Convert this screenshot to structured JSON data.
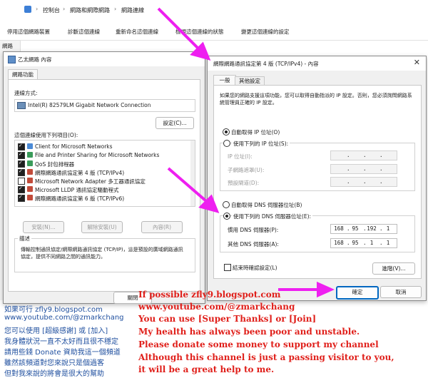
{
  "explorer": {
    "breadcrumb": [
      "控制台",
      "網路和網際網路",
      "網路連線"
    ],
    "toolbar": [
      "停用這個網路裝置",
      "診斷這個連線",
      "重新命名這個連線",
      "檢視這個連線的狀態",
      "變更這個連線的設定"
    ],
    "left_label": "網路"
  },
  "dialog1": {
    "title": "乙太網路 內容",
    "tab": "網路功能",
    "connect_using_label": "連線方式:",
    "adapter": "Intel(R) 82579LM Gigabit Network Connection",
    "configure_btn": "設定(C)...",
    "items_label": "這個連線使用下列項目(O):",
    "items": [
      {
        "label": "Client for Microsoft Networks",
        "checked": true,
        "icon": "network-client-icon"
      },
      {
        "label": "File and Printer Sharing for Microsoft Networks",
        "checked": true,
        "icon": "printer-sharing-icon"
      },
      {
        "label": "QoS 封包排程器",
        "checked": true,
        "icon": "qos-icon"
      },
      {
        "label": "網際網路通訊協定第 4 版 (TCP/IPv4)",
        "checked": true,
        "icon": "protocol-icon"
      },
      {
        "label": "Microsoft Network Adapter 多工器通訊協定",
        "checked": false,
        "icon": "protocol-icon"
      },
      {
        "label": "Microsoft LLDP 通訊協定驅動程式",
        "checked": true,
        "icon": "protocol-icon"
      },
      {
        "label": "網際網路通訊協定第 6 版 (TCP/IPv6)",
        "checked": true,
        "icon": "protocol-icon"
      }
    ],
    "install_btn": "安裝(N)...",
    "uninstall_btn": "解除安裝(U)",
    "properties_btn": "內容(R)",
    "desc_title": "描述",
    "desc_text": "傳輸控制通訊協定/網際網路通訊協定 (TCP/IP)，這是預設的廣域網路通訊協定，提供不同網路之間的通訊能力。",
    "close_btn": "關閉"
  },
  "dialog2": {
    "title": "網際網路通訊協定第 4 版 (TCP/IPv4) - 內容",
    "tabs": [
      "一般",
      "其他設定"
    ],
    "intro": "如果您的網路支援這項功能，您可以取得自動指派的 IP 設定。否則，您必須詢問網路系統管理員正確的 IP 設定。",
    "auto_ip": "自動取得 IP 位址(O)",
    "manual_ip": "使用下列的 IP 位址(S):",
    "ip_label": "IP 位址(I):",
    "mask_label": "子網路遮罩(U):",
    "gateway_label": "預設閘道(D):",
    "auto_dns": "自動取得 DNS 伺服器位址(B)",
    "manual_dns": "使用下列的 DNS 伺服器位址(E):",
    "pref_dns_label": "慣用 DNS 伺服器(P):",
    "pref_dns": [
      "168",
      "95",
      "192",
      "1"
    ],
    "alt_dns_label": "其他 DNS 伺服器(A):",
    "alt_dns": [
      "168",
      "95",
      "1",
      "1"
    ],
    "validate": "結束時確認設定(L)",
    "advanced_btn": "進階(V)...",
    "ok_btn": "確定",
    "cancel_btn": "取消"
  },
  "overlay": {
    "blue": [
      "如果可行 zfly9.blogspot.com",
      "www.youtube.com/@zmarkchang",
      "您可以使用 [超級感謝] 或 [加入]",
      "我身體狀況一直不太好而且很不穩定",
      "請用些錢 Donate 資助我這一個頻道",
      "雖然該頻道對您來說只是個過客",
      "但對我來說的將會是很大的幫助"
    ],
    "red": [
      "If possible zfly9.blogspot.com",
      "www.youtube.com/@zmarkchang",
      "You can use [Super Thanks] or [Join]",
      "My health has always been poor and unstable.",
      "Please donate some money to support my channel",
      "Although this channel is just a passing visitor to you,",
      "it will be a great help to me."
    ]
  },
  "colors": {
    "arrow": "#ee1ff0",
    "blue_text": "#1f4f9f",
    "red_text": "#e0201b",
    "accent": "#0067c0"
  }
}
